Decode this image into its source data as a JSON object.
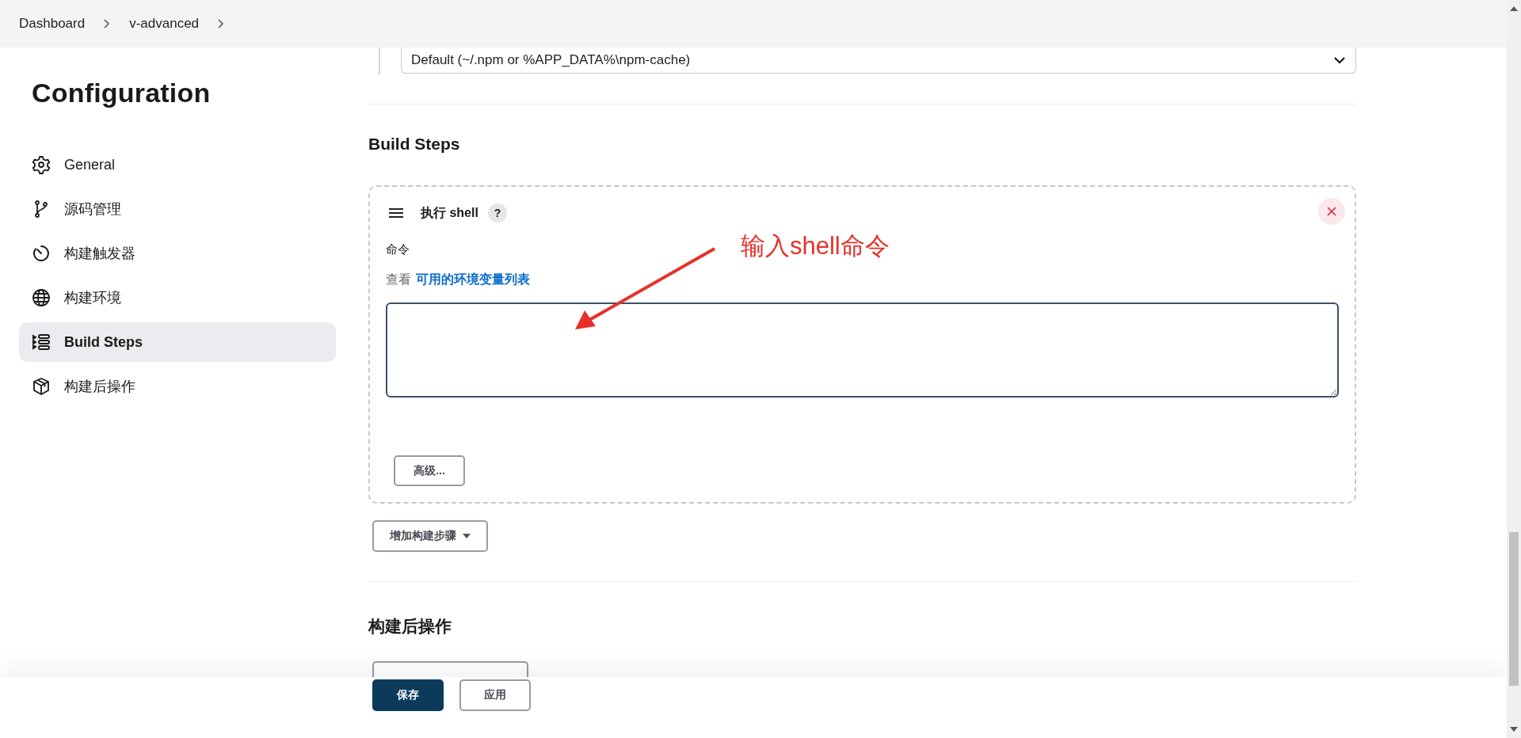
{
  "breadcrumb": [
    {
      "label": "Dashboard"
    },
    {
      "label": "v-advanced"
    }
  ],
  "sidebar": {
    "title": "Configuration",
    "items": [
      {
        "label": "General",
        "kind": "gear",
        "selected": false
      },
      {
        "label": "源码管理",
        "kind": "branch",
        "selected": false
      },
      {
        "label": "构建触发器",
        "kind": "timer",
        "selected": false
      },
      {
        "label": "构建环境",
        "kind": "globe",
        "selected": false
      },
      {
        "label": "Build Steps",
        "kind": "steps",
        "selected": true
      },
      {
        "label": "构建后操作",
        "kind": "package",
        "selected": false
      }
    ]
  },
  "npm_cache_select": {
    "value": "Default (~/.npm or %APP_DATA%\\npm-cache)"
  },
  "build_steps": {
    "title": "Build Steps",
    "step": {
      "title": "执行 shell",
      "help": "?",
      "field_label": "命令",
      "hint": "查看",
      "link": "可用的环境变量列表",
      "advanced_button": "高级..."
    },
    "add_button": "增加构建步骤"
  },
  "post_build": {
    "title": "构建后操作"
  },
  "footer": {
    "buttons": [
      {
        "label": "保存",
        "kind": "primary"
      },
      {
        "label": "应用",
        "kind": "secondary"
      }
    ]
  },
  "annotation": {
    "text": "输入shell命令"
  }
}
